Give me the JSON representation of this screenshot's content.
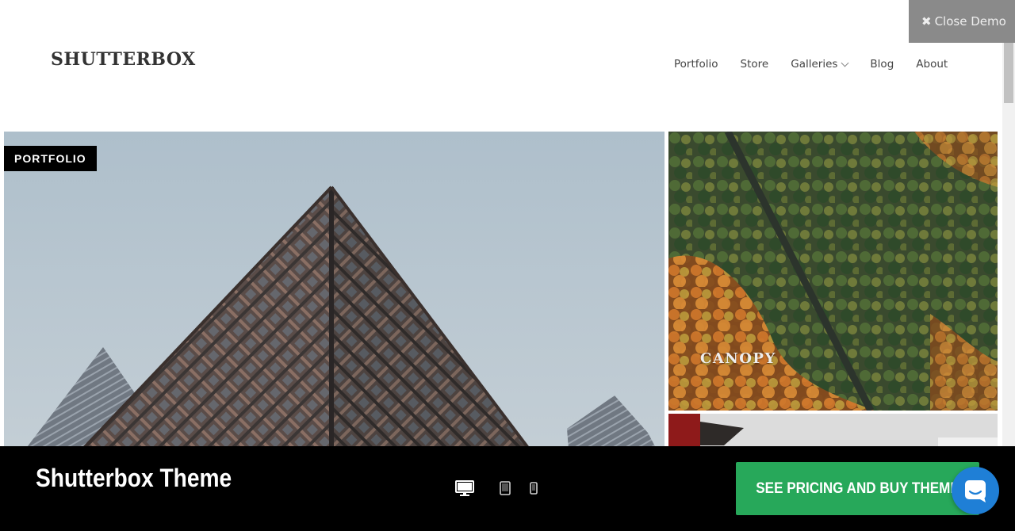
{
  "header": {
    "logo": "SHUTTERBOX",
    "nav": [
      {
        "label": "Portfolio"
      },
      {
        "label": "Store"
      },
      {
        "label": "Galleries"
      },
      {
        "label": "Blog"
      },
      {
        "label": "About"
      }
    ],
    "close_demo": "Close Demo"
  },
  "gallery": {
    "badge": "PORTFOLIO",
    "tiles": [
      {
        "label": ""
      },
      {
        "label": "CANOPY"
      },
      {
        "label": ""
      }
    ]
  },
  "demo_bar": {
    "title": "Shutterbox Theme",
    "devices": [
      "desktop-icon",
      "tablet-icon",
      "mobile-icon"
    ],
    "buy_label": "SEE PRICING AND BUY THEME"
  },
  "colors": {
    "buy_button": "#27a85a",
    "chat_button": "#1f7fd6",
    "close_demo_bg": "#8a8a8a"
  }
}
